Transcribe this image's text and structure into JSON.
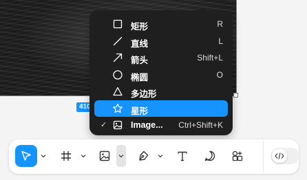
{
  "canvas": {
    "dimension_badge": "410"
  },
  "shape_menu": {
    "items": [
      {
        "icon": "square-icon",
        "label": "矩形",
        "shortcut": "R",
        "checked": false,
        "active": false
      },
      {
        "icon": "line-icon",
        "label": "直线",
        "shortcut": "L",
        "checked": false,
        "active": false
      },
      {
        "icon": "arrow-icon",
        "label": "箭头",
        "shortcut": "Shift+L",
        "checked": false,
        "active": false
      },
      {
        "icon": "ellipse-icon",
        "label": "椭圆",
        "shortcut": "O",
        "checked": false,
        "active": false
      },
      {
        "icon": "polygon-icon",
        "label": "多边形",
        "shortcut": "",
        "checked": false,
        "active": false
      },
      {
        "icon": "star-icon",
        "label": "星形",
        "shortcut": "",
        "checked": false,
        "active": true
      },
      {
        "icon": "image-icon",
        "label": "Image...",
        "shortcut": "Ctrl+Shift+K",
        "checked": true,
        "active": false
      }
    ],
    "check_mark": "✓"
  },
  "toolbar": {
    "tools": [
      {
        "name": "move-tool",
        "icon": "cursor-icon",
        "active": true
      },
      {
        "name": "frame-tool",
        "icon": "frame-icon",
        "active": false
      },
      {
        "name": "image-tool",
        "icon": "image-icon",
        "active": false
      },
      {
        "name": "pen-tool",
        "icon": "pen-icon",
        "active": false
      },
      {
        "name": "text-tool",
        "icon": "text-icon",
        "active": false
      },
      {
        "name": "comment-tool",
        "icon": "comment-icon",
        "active": false
      },
      {
        "name": "plugins-tool",
        "icon": "components-icon",
        "active": false
      }
    ],
    "dev_mode": {
      "icon": "code-icon",
      "enabled": false
    }
  },
  "colors": {
    "accent": "#1593ff",
    "menu_bg": "#1f1f1f",
    "canvas_bg": "#f4f4f4"
  }
}
